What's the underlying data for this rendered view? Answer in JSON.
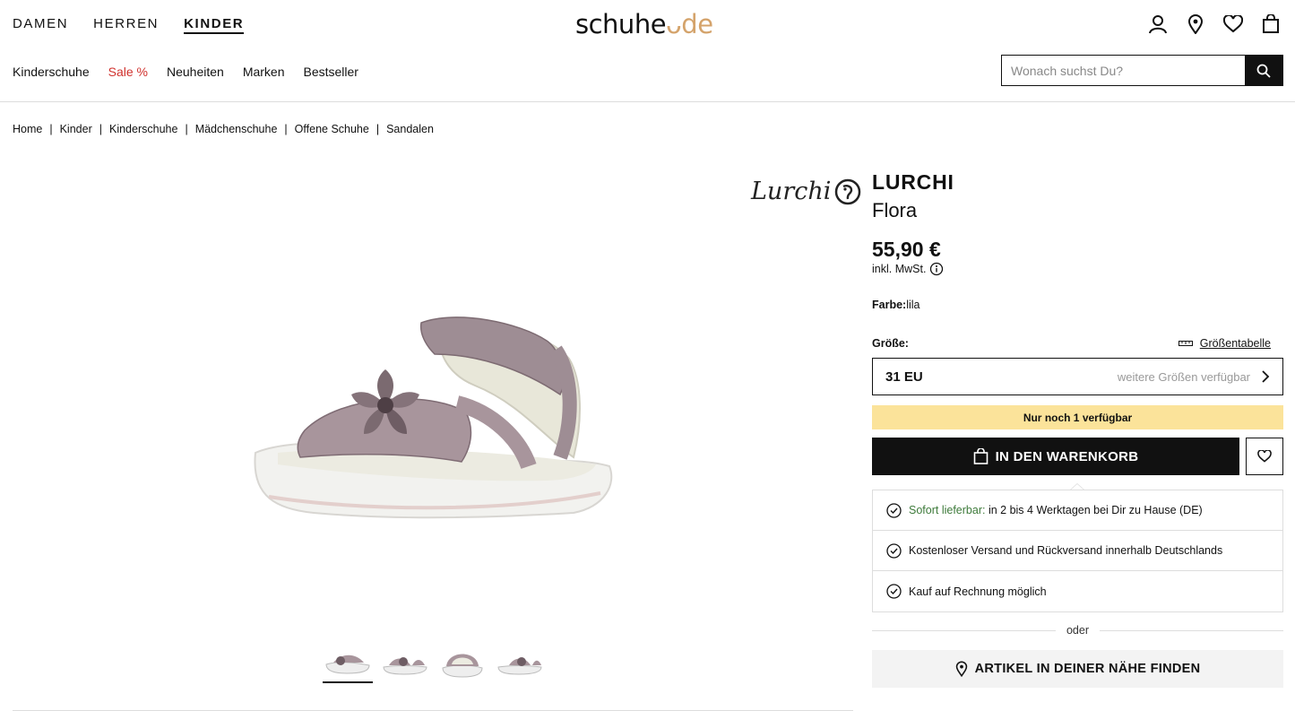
{
  "header": {
    "top_nav": [
      "DAMEN",
      "HERREN",
      "KINDER"
    ],
    "logo_text": "schuhe",
    "logo_tld": "de",
    "icons": [
      "user-icon",
      "location-pin-icon",
      "heart-icon",
      "bag-icon"
    ]
  },
  "subnav": [
    "Kinderschuhe",
    "Sale %",
    "Neuheiten",
    "Marken",
    "Bestseller"
  ],
  "search": {
    "placeholder": "Wonach suchst Du?"
  },
  "breadcrumb": [
    "Home",
    "Kinder",
    "Kinderschuhe",
    "Mädchenschuhe",
    "Offene Schuhe",
    "Sandalen"
  ],
  "product": {
    "brand_logo_text": "Lurchi",
    "brand": "LURCHI",
    "model": "Flora",
    "price": "55,90 €",
    "vat_note": "inkl. MwSt.",
    "color_label": "Farbe:",
    "color_value": "lila",
    "size_label": "Größe:",
    "size_chart_label": "Größentabelle",
    "size_value": "31 EU",
    "more_sizes": "weitere Größen verfügbar",
    "stock_note": "Nur noch 1 verfügbar",
    "cart_button": "IN DEN WARENKORB",
    "thumbnail_count": 4,
    "active_thumbnail": 1
  },
  "benefits": {
    "delivery_highlight": "Sofort lieferbar:",
    "delivery_text": "in 2 bis 4 Werktagen bei Dir zu Hause (DE)",
    "shipping": "Kostenloser Versand und Rückversand innerhalb Deutschlands",
    "invoice": "Kauf auf Rechnung möglich"
  },
  "or_label": "oder",
  "store_button": "ARTIKEL IN DEINER NÄHE FINDEN",
  "colors": {
    "accent_sale": "#d0312d",
    "stock_bg": "#fbe39a",
    "logo_accent": "#d4a36b",
    "delivery_green": "#3d7a3a"
  }
}
